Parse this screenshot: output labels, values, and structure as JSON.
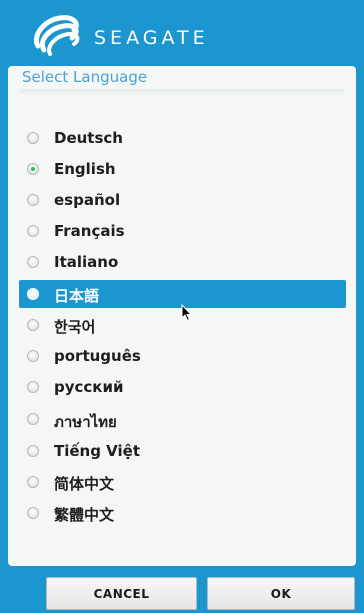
{
  "header": {
    "brand": "SEAGATE",
    "logo_icon": "seagate-logo-icon",
    "brand_color": "#1b96cf"
  },
  "panel": {
    "title": "Select Language",
    "title_color": "#4aa3d3"
  },
  "languages": [
    {
      "label": "Deutsch",
      "checked": false,
      "selected": false
    },
    {
      "label": "English",
      "checked": true,
      "selected": false
    },
    {
      "label": "español",
      "checked": false,
      "selected": false
    },
    {
      "label": "Français",
      "checked": false,
      "selected": false
    },
    {
      "label": "Italiano",
      "checked": false,
      "selected": false
    },
    {
      "label": "日本語",
      "checked": false,
      "selected": true
    },
    {
      "label": "한국어",
      "checked": false,
      "selected": false
    },
    {
      "label": "português",
      "checked": false,
      "selected": false
    },
    {
      "label": "русский",
      "checked": false,
      "selected": false
    },
    {
      "label": "ภาษาไทย",
      "checked": false,
      "selected": false
    },
    {
      "label": "Tiếng Việt",
      "checked": false,
      "selected": false
    },
    {
      "label": "简体中文",
      "checked": false,
      "selected": false
    },
    {
      "label": "繁體中文",
      "checked": false,
      "selected": false
    }
  ],
  "buttons": {
    "cancel": "CANCEL",
    "ok": "OK"
  },
  "colors": {
    "accent": "#1b96cf",
    "radio_checked": "#32c24a"
  }
}
